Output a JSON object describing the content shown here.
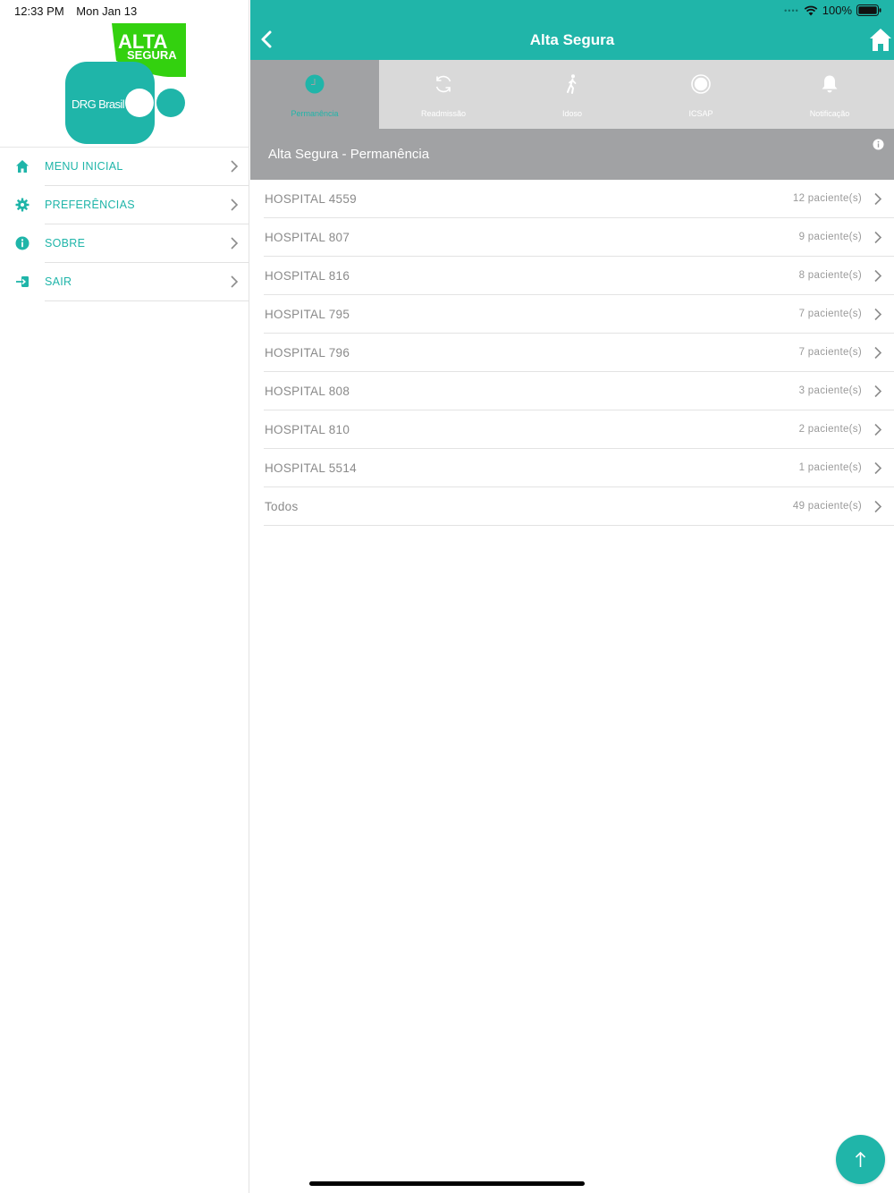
{
  "status": {
    "time": "12:33 PM",
    "date": "Mon Jan 13",
    "battery": "100%"
  },
  "logo": {
    "line1": "ALTA",
    "line2": "SEGURA",
    "brand": "DRG Brasil"
  },
  "sidebar": {
    "items": [
      {
        "label": "MENU INICIAL",
        "icon": "home-icon"
      },
      {
        "label": "PREFERÊNCIAS",
        "icon": "gear-icon"
      },
      {
        "label": "SOBRE",
        "icon": "info-icon"
      },
      {
        "label": "SAIR",
        "icon": "logout-icon"
      }
    ]
  },
  "header": {
    "title": "Alta Segura"
  },
  "tabs": [
    {
      "label": "Permanência",
      "icon": "clock-icon",
      "active": true
    },
    {
      "label": "Readmissão",
      "icon": "refresh-icon",
      "active": false
    },
    {
      "label": "Idoso",
      "icon": "walking-person-icon",
      "active": false
    },
    {
      "label": "ICSAP",
      "icon": "target-icon",
      "active": false
    },
    {
      "label": "Notificação",
      "icon": "bell-icon",
      "active": false
    }
  ],
  "section": {
    "title": "Alta Segura - Permanência"
  },
  "hospitals": [
    {
      "name": "HOSPITAL 4559",
      "count": "12 paciente(s)"
    },
    {
      "name": "HOSPITAL 807",
      "count": "9 paciente(s)"
    },
    {
      "name": "HOSPITAL 816",
      "count": "8 paciente(s)"
    },
    {
      "name": "HOSPITAL 795",
      "count": "7 paciente(s)"
    },
    {
      "name": "HOSPITAL 796",
      "count": "7 paciente(s)"
    },
    {
      "name": "HOSPITAL 808",
      "count": "3 paciente(s)"
    },
    {
      "name": "HOSPITAL 810",
      "count": "2 paciente(s)"
    },
    {
      "name": "HOSPITAL 5514",
      "count": "1 paciente(s)"
    },
    {
      "name": "Todos",
      "count": "49 paciente(s)"
    }
  ],
  "colors": {
    "accent": "#20b5a9",
    "logo_green": "#33d10f",
    "tab_bar": "#d9d9d9",
    "active_tab": "#a1a2a4",
    "row_text": "#8a8a8a"
  }
}
